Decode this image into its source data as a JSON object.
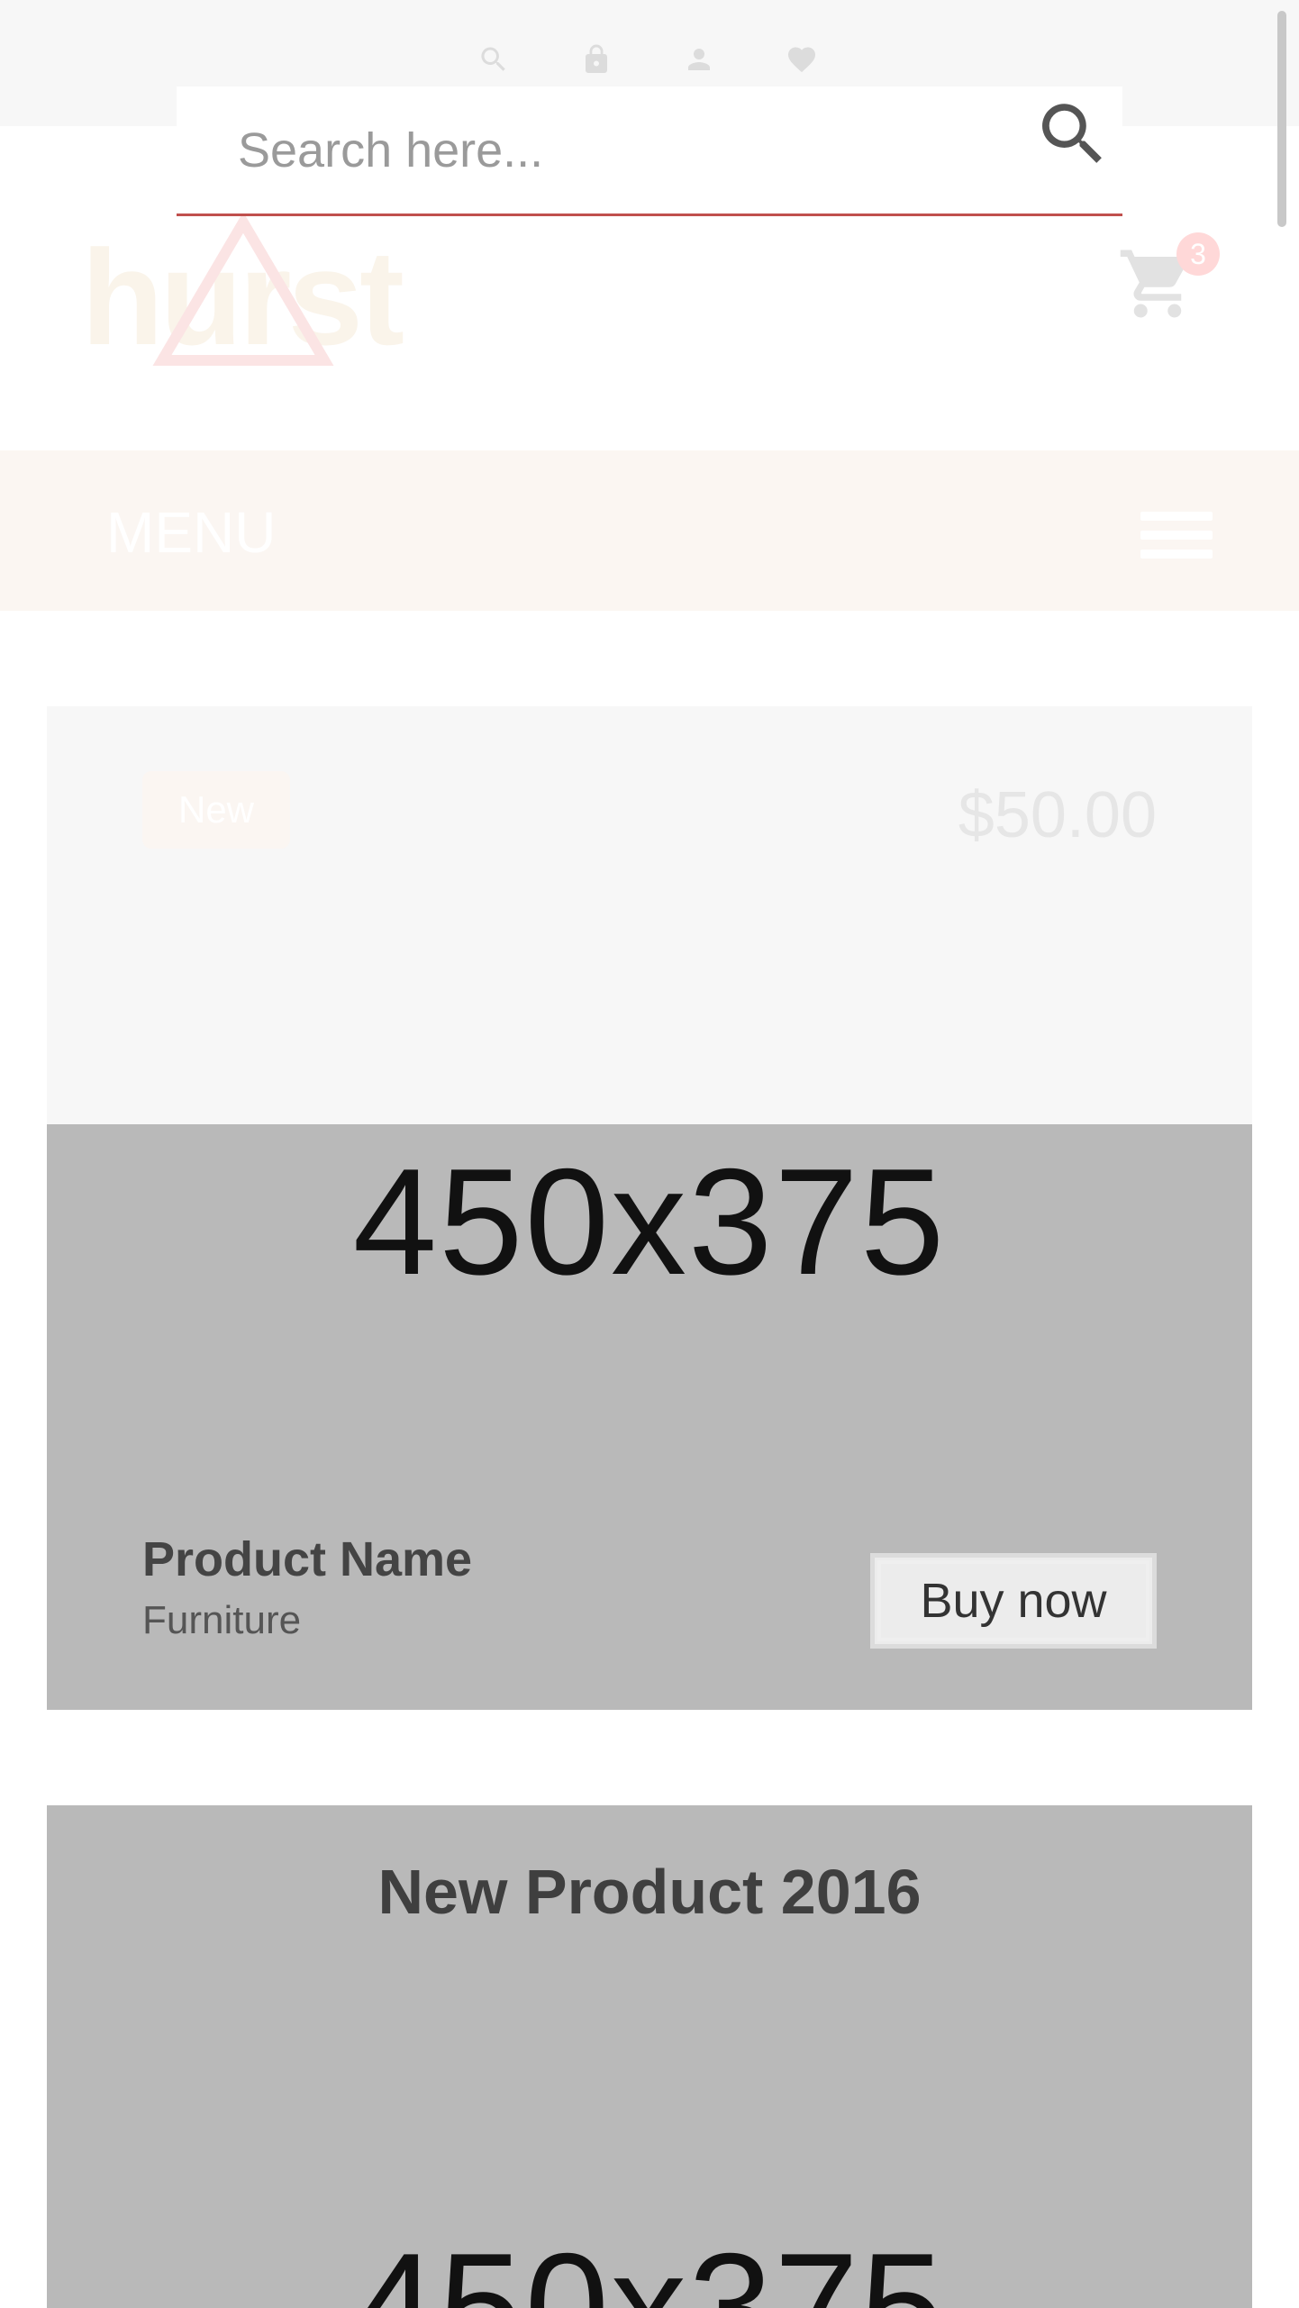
{
  "top_bar": {
    "icons": [
      "search-icon",
      "lock-icon",
      "user-icon",
      "heart-icon"
    ]
  },
  "search": {
    "placeholder": "Search here...",
    "value": ""
  },
  "header": {
    "logo_text": "hurst",
    "cart_count": "3"
  },
  "menu": {
    "label": "MENU"
  },
  "products": [
    {
      "badge": "New",
      "price": "$50.00",
      "image_placeholder": "450x375",
      "name": "Product Name",
      "category": "Furniture",
      "button_label": "Buy now"
    },
    {
      "title": "New Product 2016",
      "image_placeholder": "450x375"
    }
  ],
  "colors": {
    "accent_underline": "#c0504d",
    "card_bg": "#b9b9b9",
    "menu_bg": "#fbf6f2"
  }
}
